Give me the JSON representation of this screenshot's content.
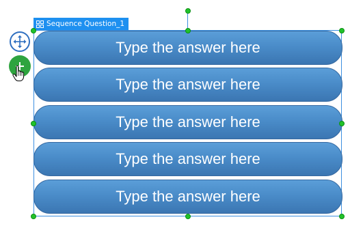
{
  "object": {
    "tag_label": "Sequence Question_1",
    "tag_icon": "grid-icon"
  },
  "answers": [
    {
      "text": "Type the answer here"
    },
    {
      "text": "Type the answer here"
    },
    {
      "text": "Type the answer here"
    },
    {
      "text": "Type the answer here"
    },
    {
      "text": "Type the answer here"
    }
  ],
  "controls": {
    "move_icon": "move-arrows-icon",
    "add_icon": "plus-icon",
    "cursor": "hand-pointer-icon"
  },
  "colors": {
    "selection": "#3b8fe0",
    "handle": "#22c22a",
    "tag_background": "#1e90f0",
    "answer_fill": "#4a8cc9",
    "add_button": "#2ea43f"
  }
}
